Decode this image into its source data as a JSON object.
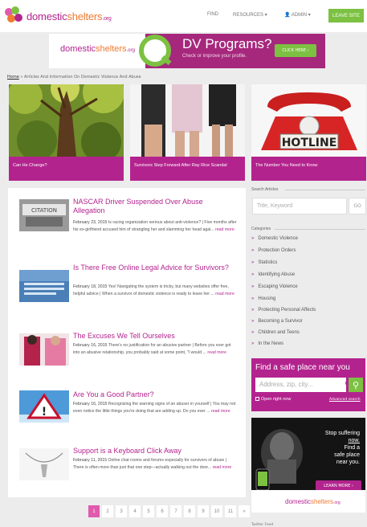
{
  "header": {
    "logo": {
      "domestic": "domestic",
      "shelters": "shelters",
      "org": ".org"
    },
    "nav": [
      {
        "label": "FIND"
      },
      {
        "label": "RESOURCES ▾"
      },
      {
        "label": "👤 ADMIN ▾"
      }
    ],
    "leave_site": "LEAVE SITE"
  },
  "banner": {
    "logo": {
      "domestic": "domestic",
      "shelters": "shelters",
      "org": ".org"
    },
    "title": "DV Programs?",
    "subtitle": "Check or improve your profile.",
    "cta": "CLICK HERE ›"
  },
  "breadcrumb": {
    "home": "Home",
    "sep": "»",
    "current": "Articles And Information On Domestic Violence And Abuse"
  },
  "features": [
    {
      "caption": "Can He Change?"
    },
    {
      "caption": "Survivors Step Forward After Ray Rice Scandal"
    },
    {
      "caption": "The Number You Need to Know"
    }
  ],
  "articles": [
    {
      "title": "NASCAR Driver Suspended Over Abuse Allegation",
      "date": "February 23, 2015",
      "excerpt": "Is racing organization serious about anti-violence? | Five months after his ex-girlfriend accused him of strangling her and slamming her head agai...",
      "read_more": "read more"
    },
    {
      "title": "Is There Free Online Legal Advice for Survivors?",
      "date": "February 18, 2015",
      "excerpt": "Yes! Navigating the system is tricky, but many websites offer free, helpful advice | When a survivor of domestic violence is ready to leave her ...",
      "read_more": "read more"
    },
    {
      "title": "The Excuses We Tell Ourselves",
      "date": "February 16, 2015",
      "excerpt": "There's no justification for an abusive partner | Before you ever got into an abusive relationship, you probably said at some point, \"I would ...",
      "read_more": "read more"
    },
    {
      "title": "Are You a Good Partner?",
      "date": "February 16, 2015",
      "excerpt": "Recognizing the warning signs of an abuser in yourself | You may not even notice the little things you're doing that are adding up. Do you ever ...",
      "read_more": "read more"
    },
    {
      "title": "Support is a Keyboard Click Away",
      "date": "February 11, 2015",
      "excerpt": "Online chat rooms and forums especially for survivors of abuse | There is often more than just that one step—actually walking out the door...",
      "read_more": "read more"
    }
  ],
  "pagination": [
    "1",
    "2",
    "3",
    "4",
    "5",
    "6",
    "7",
    "8",
    "9",
    "10",
    "11",
    "»"
  ],
  "sidebar": {
    "search_heading": "Search Articles",
    "search_placeholder": "Title, Keyword",
    "go": "GO",
    "categories_heading": "Categories",
    "categories": [
      "Domestic Violence",
      "Protection Orders",
      "Statistics",
      "Identifying Abuse",
      "Escaping Violence",
      "Housing",
      "Protecting Personal Affects",
      "Becoming a Survivor",
      "Children and Teens",
      "In the News"
    ],
    "safe_place": {
      "heading": "Find a safe place near you",
      "placeholder": "Address, zip, city...",
      "open_now": "Open right now",
      "advanced": "Advanced search"
    },
    "ad": {
      "line1": "Stop suffering",
      "line2": "now.",
      "line3": "Find a",
      "line4": "safe place",
      "line5": "near you.",
      "learn_more": "LEARN MORE ›",
      "logo": {
        "domestic": "domestic",
        "shelters": "shelters",
        "org": ".org"
      }
    },
    "twitter_heading": "Twitter Feed"
  },
  "colors": {
    "brand": "#b3238e",
    "accent": "#7cc142",
    "orange": "#ef7a2f"
  }
}
